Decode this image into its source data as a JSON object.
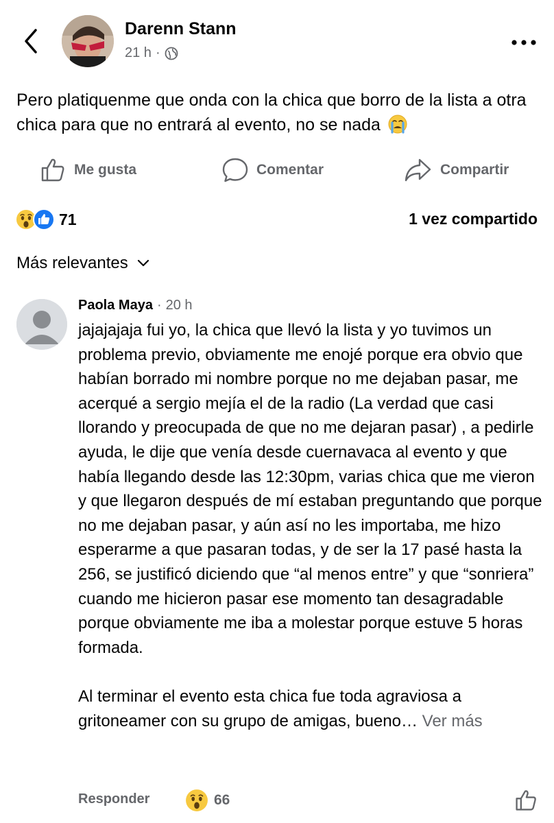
{
  "post": {
    "author": "Darenn Stann",
    "time": "21 h",
    "separator": "·",
    "privacy_icon": "globe-icon",
    "text": "Pero platiquenme que onda con la chica que borro de la lista a otra chica para que no entrará al evento, no se nada",
    "text_emoji": "crying-face-emoji"
  },
  "actions": {
    "like_label": "Me gusta",
    "comment_label": "Comentar",
    "share_label": "Compartir"
  },
  "stats": {
    "reaction_icons": [
      "wow-reaction-icon",
      "like-reaction-icon"
    ],
    "reaction_count": "71",
    "shares_label": "1 vez compartido"
  },
  "sort": {
    "label": "Más relevantes"
  },
  "comment": {
    "name": "Paola Maya",
    "separator": "·",
    "time": "20 h",
    "paragraph1": "jajajajaja fui yo, la chica que llevó la lista y yo tuvimos un problema previo, obviamente me enojé porque era obvio que habían borrado mi nombre porque no me dejaban pasar, me acerqué a sergio mejía el de la radio (La verdad que casi llorando y preocupada de que no me dejaran pasar) , a pedirle ayuda, le dije que venía desde cuernavaca al evento y que había llegando desde las 12:30pm, varias chica que me vieron y que llegaron después de mí estaban preguntando que porque no me dejaban pasar, y aún así no les importaba, me hizo esperarme a que pasaran todas, y de ser la 17 pasé hasta la 256, se justificó diciendo que “al menos entre” y que “sonriera” cuando me hicieron pasar ese momento tan desagradable porque obviamente me iba a molestar porque estuve 5 horas formada.",
    "paragraph2": "Al terminar el evento esta chica fue toda agraviosa a gritoneamer con su grupo de amigas, bueno…",
    "see_more": "Ver más",
    "reply_label": "Responder",
    "reaction_icon": "wow-reaction-icon",
    "reaction_count": "66"
  },
  "colors": {
    "text": "#050505",
    "secondary": "#65676b",
    "like_blue": "#1877f2",
    "emoji_yellow": "#f7c940"
  }
}
